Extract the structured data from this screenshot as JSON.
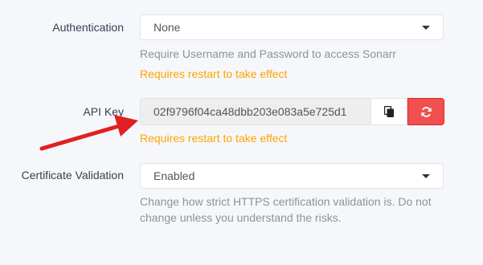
{
  "authentication": {
    "label": "Authentication",
    "value": "None",
    "help": "Require Username and Password to access Sonarr",
    "warning": "Requires restart to take effect"
  },
  "api_key": {
    "label": "API Key",
    "value": "02f9796f04ca48dbb203e083a5e725d1",
    "warning": "Requires restart to take effect",
    "copy_icon": "copy-icon",
    "regenerate_icon": "refresh-icon"
  },
  "certificate_validation": {
    "label": "Certificate Validation",
    "value": "Enabled",
    "help": "Change how strict HTTPS certification validation is. Do not change unless you understand the risks."
  },
  "annotation": {
    "arrow_color": "#e02020"
  },
  "colors": {
    "warning": "#ffa500",
    "danger": "#f05050",
    "help_text": "#909293"
  }
}
